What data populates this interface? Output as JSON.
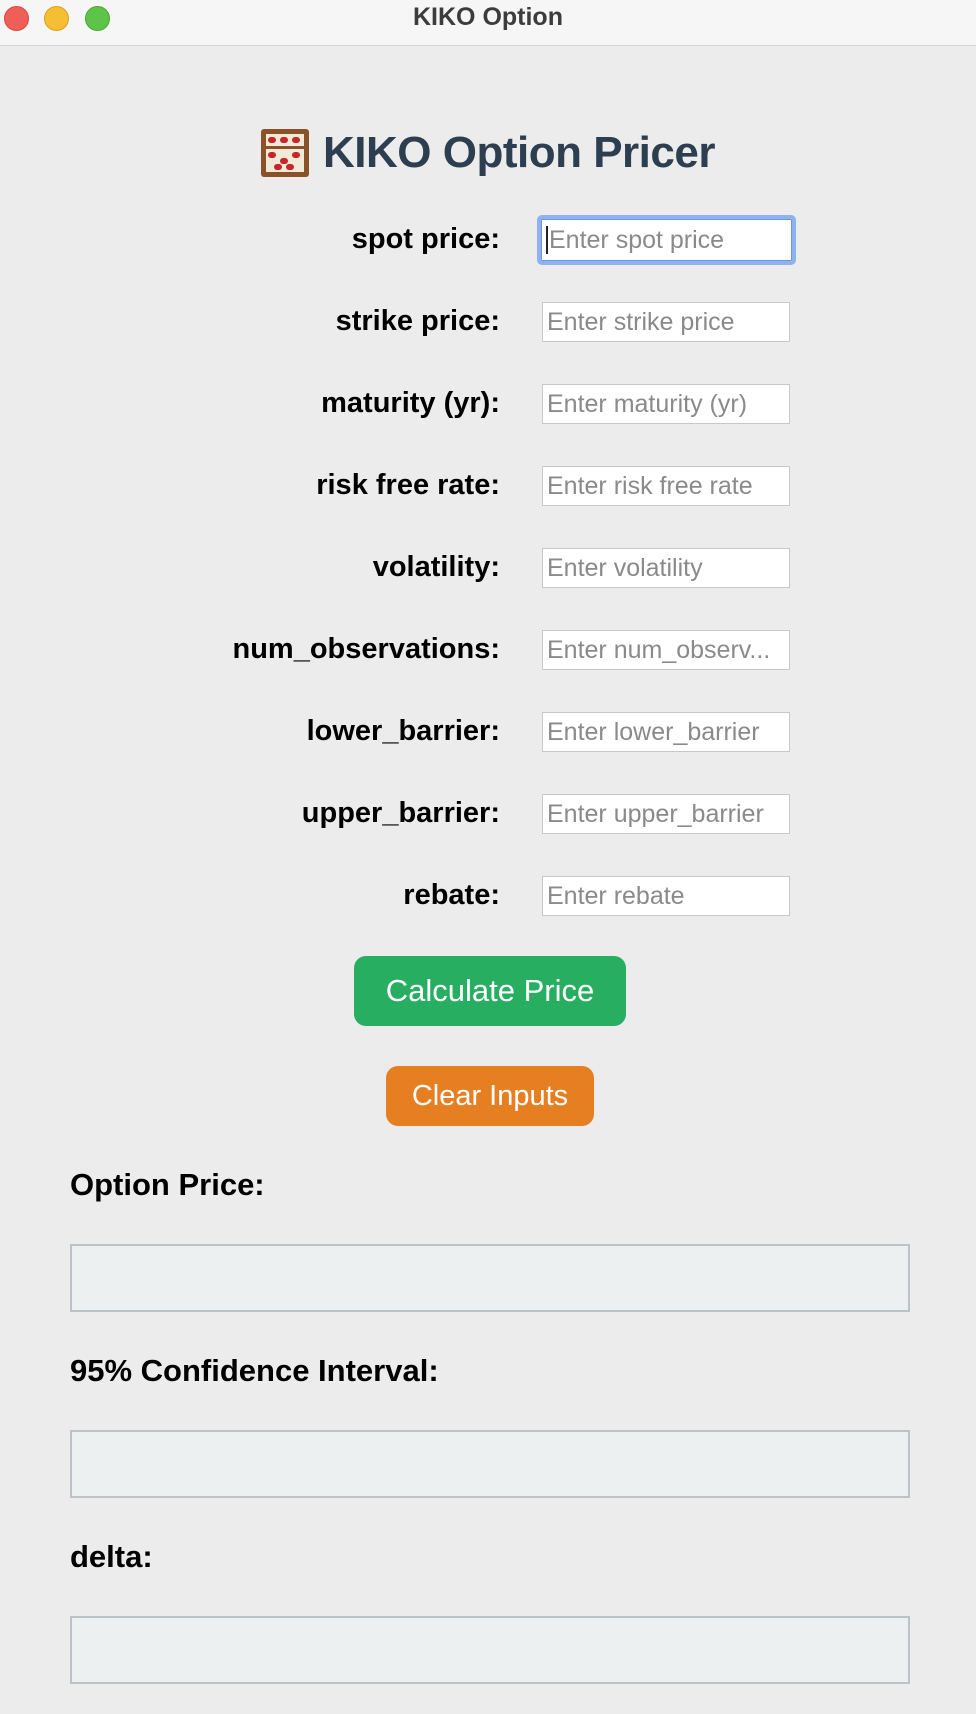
{
  "window": {
    "title": "KIKO Option"
  },
  "app": {
    "heading": "KIKO Option Pricer",
    "heading_icon": "abacus-icon"
  },
  "form": {
    "fields": [
      {
        "label": "spot price:",
        "placeholder": "Enter spot price",
        "value": ""
      },
      {
        "label": "strike price:",
        "placeholder": "Enter strike price",
        "value": ""
      },
      {
        "label": "maturity (yr):",
        "placeholder": "Enter maturity (yr)",
        "value": ""
      },
      {
        "label": "risk free rate:",
        "placeholder": "Enter risk free rate",
        "value": ""
      },
      {
        "label": "volatility:",
        "placeholder": "Enter volatility",
        "value": ""
      },
      {
        "label": "num_observations:",
        "placeholder": "Enter num_observ...",
        "value": ""
      },
      {
        "label": "lower_barrier:",
        "placeholder": "Enter lower_barrier",
        "value": ""
      },
      {
        "label": "upper_barrier:",
        "placeholder": "Enter upper_barrier",
        "value": ""
      },
      {
        "label": "rebate:",
        "placeholder": "Enter rebate",
        "value": ""
      }
    ]
  },
  "buttons": {
    "calculate": "Calculate Price",
    "clear": "Clear Inputs"
  },
  "outputs": [
    {
      "label": "Option Price:",
      "value": ""
    },
    {
      "label": "95% Confidence Interval:",
      "value": ""
    },
    {
      "label": "delta:",
      "value": ""
    }
  ],
  "colors": {
    "heading": "#2c3e50",
    "calculate_button": "#27ae60",
    "clear_button": "#e67e22",
    "focus_ring": "#8fb2ef"
  }
}
